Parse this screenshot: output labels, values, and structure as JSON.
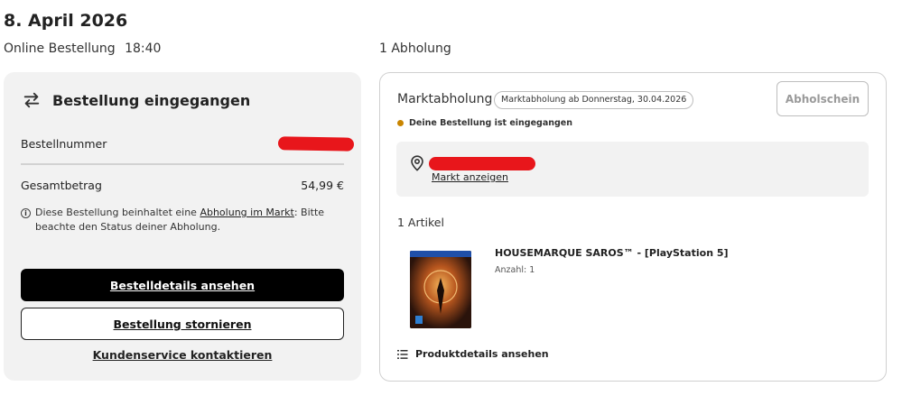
{
  "header": {
    "date": "8. April 2026",
    "order_type": "Online Bestellung",
    "order_time": "18:40",
    "pickup_count": "1 Abholung"
  },
  "order_card": {
    "status_title": "Bestellung eingegangen",
    "status_icon": "arrows-swap-icon",
    "order_number_label": "Bestellnummer",
    "total_label": "Gesamtbetrag",
    "total_value": "54,99 €",
    "info_text_before": "Diese Bestellung beinhaltet eine ",
    "info_link": "Abholung im Markt",
    "info_text_after": ": Bitte beachte den Status deiner Abholung.",
    "details_button": "Bestelldetails ansehen",
    "cancel_button": "Bestellung stornieren",
    "support_link": "Kundenservice kontaktieren"
  },
  "pickup_card": {
    "title": "Marktabholung",
    "badge": "Marktabholung ab Donnerstag, 30.04.2026",
    "slip_button": "Abholschein",
    "status": "Deine Bestellung ist eingegangen",
    "status_color": "#c98500",
    "store_link": "Markt anzeigen",
    "item_count": "1 Artikel",
    "product": {
      "name": "HOUSEMARQUE SAROS™ - [PlayStation 5]",
      "quantity": "Anzahl: 1",
      "cover_title": "SAROS",
      "cover_rating": "16"
    },
    "product_details_link": "Produktdetails ansehen"
  },
  "colors": {
    "redaction": "#e8161b",
    "primary_button": "#000000",
    "card_background": "#f2f2f2"
  }
}
